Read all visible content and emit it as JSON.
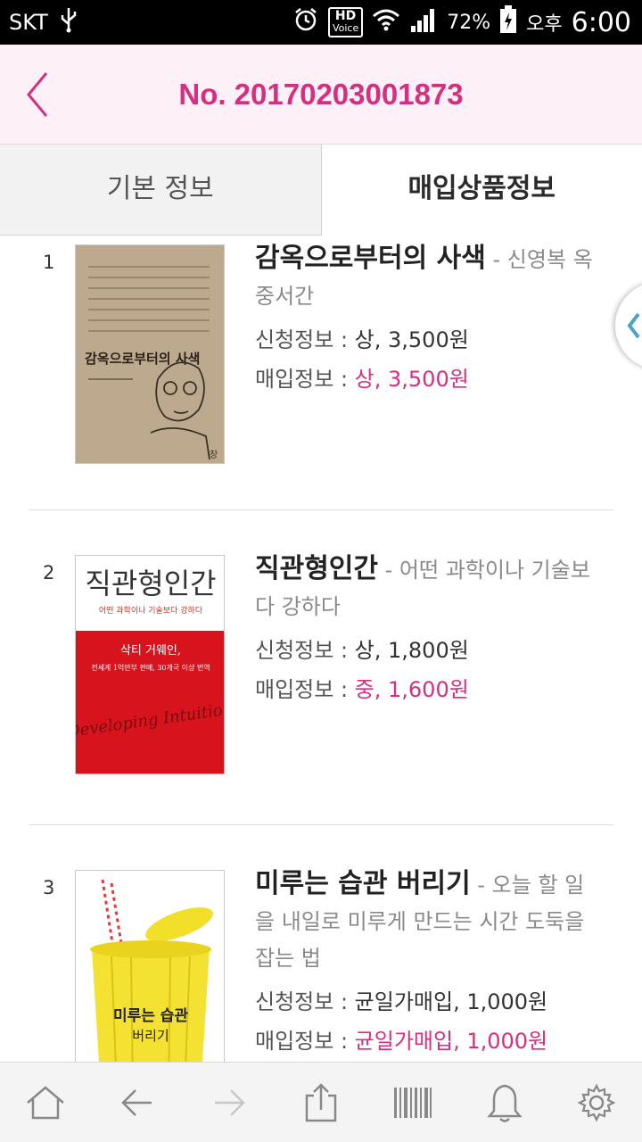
{
  "status_bar": {
    "carrier": "SKT",
    "hd_label": "HD",
    "voice_label": "Voice",
    "battery": "72%",
    "ampm": "오후",
    "time": "6:00"
  },
  "header": {
    "title": "No. 20170203001873"
  },
  "tabs": [
    {
      "label": "기본 정보",
      "active": false
    },
    {
      "label": "매입상품정보",
      "active": true
    }
  ],
  "labels": {
    "request": "신청정보 : ",
    "purchase": "매입정보 : "
  },
  "items": [
    {
      "num": "1",
      "title": "감옥으로부터의 사색",
      "subtitle": " - 신영복 옥중서간",
      "request": "상, 3,500원",
      "purchase": "상, 3,500원",
      "cover_text": "감옥으로부터의 사색"
    },
    {
      "num": "2",
      "title": "직관형인간",
      "subtitle": " - 어떤 과학이나 기술보다 강하다",
      "request": "상, 1,800원",
      "purchase": "중, 1,600원",
      "cover_title": "직관형인간",
      "cover_sub": "어떤 과학이나 기술보다 강하다",
      "cover_author": "삭티 거웨인,",
      "cover_desc": "전세계 1억만부 판매, 30개국 이상 번역",
      "cover_script": "Developing Intuition"
    },
    {
      "num": "3",
      "title": "미루는 습관 버리기",
      "subtitle": " - 오늘 할 일을 내일로 미루게 만드는 시간 도둑을 잡는 법",
      "request": "균일가매입, 1,000원",
      "purchase": "균일가매입, 1,000원",
      "cover_title_1": "미루는 습관",
      "cover_title_2": "버리기"
    }
  ],
  "bottom_bar": [
    "home-icon",
    "back-arrow-icon",
    "forward-arrow-icon",
    "share-icon",
    "barcode-icon",
    "bell-icon",
    "gear-icon"
  ],
  "colors": {
    "accent": "#d62f7f",
    "header_bg": "#fdf0f6"
  }
}
